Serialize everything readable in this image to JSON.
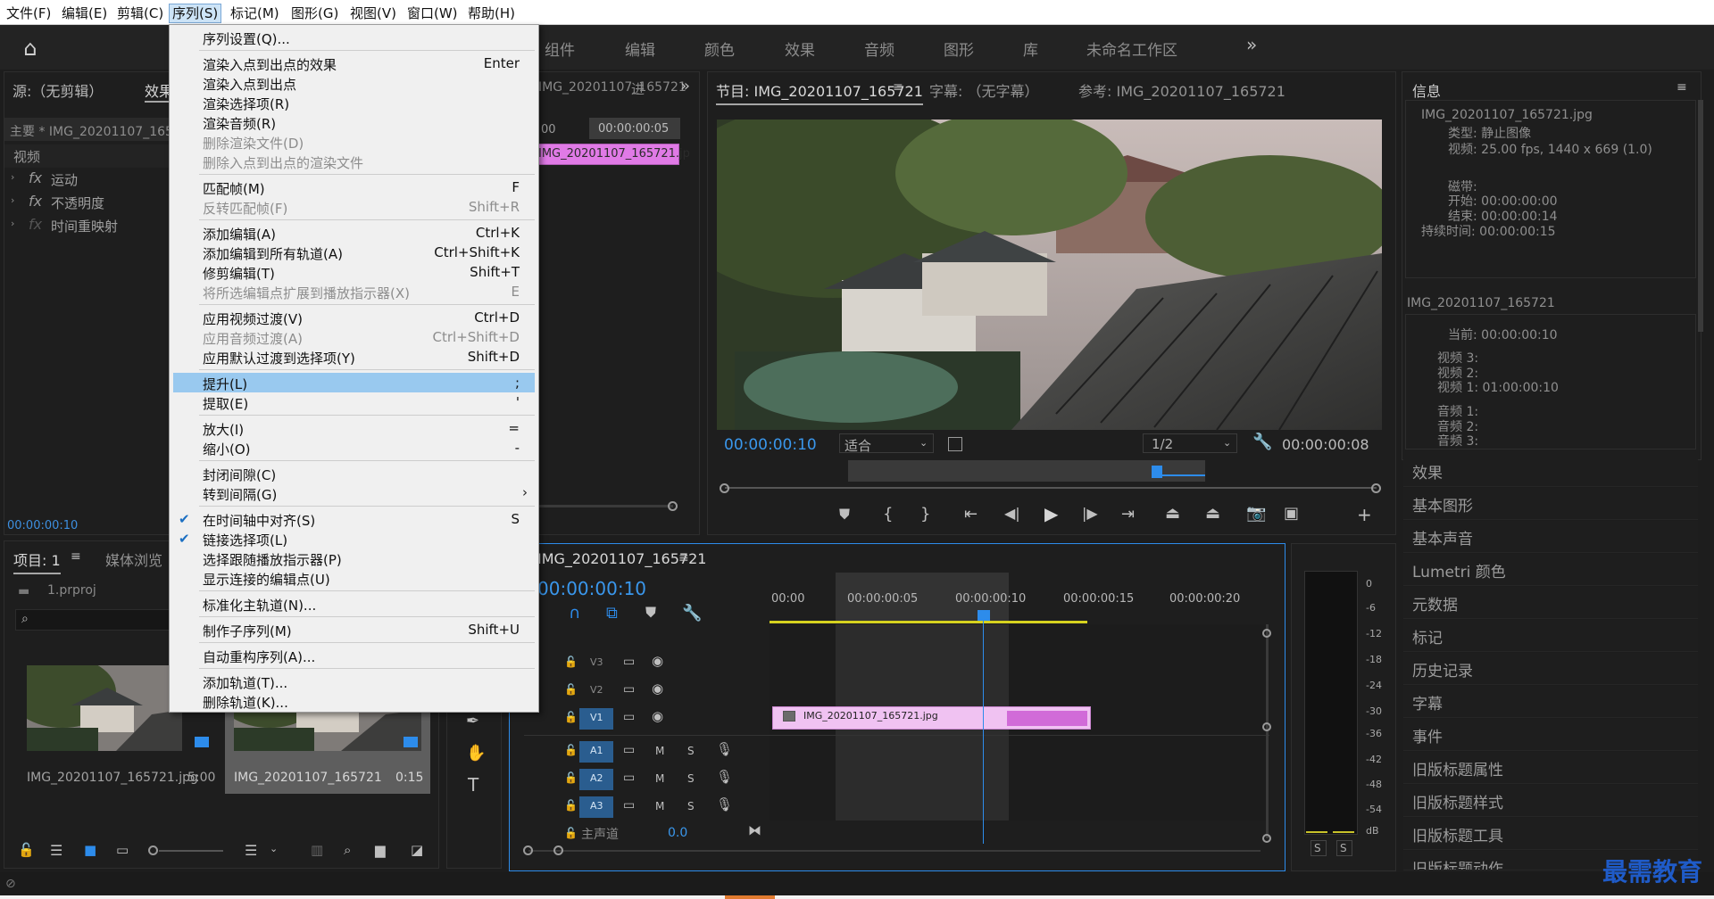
{
  "menubar": {
    "items": [
      "文件(F)",
      "编辑(E)",
      "剪辑(C)",
      "序列(S)",
      "标记(M)",
      "图形(G)",
      "视图(V)",
      "窗口(W)",
      "帮助(H)"
    ]
  },
  "workspaces": [
    "组件",
    "编辑",
    "颜色",
    "效果",
    "音频",
    "图形",
    "库",
    "未命名工作区"
  ],
  "source_panel": {
    "title": "源:（无剪辑）",
    "effects_tab": "效果",
    "clip_label": "主要 * IMG_20201107_165",
    "video": "视频",
    "effects": [
      "运动",
      "不透明度",
      "时间重映射"
    ],
    "timecode": "00:00:00:10"
  },
  "mini_timeline": {
    "clip_name": "IMG_20201107_165721",
    "tab": "进",
    "tc_left": "00",
    "tc": "00:00:00:05",
    "clip": "IMG_20201107_165721.jp"
  },
  "program": {
    "title": "节目: IMG_20201107_165721",
    "captions": "字幕: （无字幕）",
    "reference": "参考: IMG_20201107_165721",
    "timecode": "00:00:00:10",
    "fit": "适合",
    "resolution": "1/2",
    "duration": "00:00:00:08"
  },
  "info_panel": {
    "title": "信息",
    "file": "IMG_20201107_165721.jpg",
    "type": "类型: 静止图像",
    "video": "视频: 25.00 fps, 1440 x 669 (1.0)",
    "tape_label": "磁带:",
    "start": "开始: 00:00:00:00",
    "end": "结束: 00:00:00:14",
    "duration": "持续时间: 00:00:00:15",
    "seq_name": "IMG_20201107_165721",
    "current": "当前: 00:00:00:10",
    "v3": "视频 3:",
    "v2": "视频 2:",
    "v1": "视频 1: 01:00:00:10",
    "a1": "音频 1:",
    "a2": "音频 2:",
    "a3": "音频 3:"
  },
  "right_panels": [
    "效果",
    "基本图形",
    "基本声音",
    "Lumetri 颜色",
    "元数据",
    "标记",
    "历史记录",
    "字幕",
    "事件",
    "旧版标题属性",
    "旧版标题样式",
    "旧版标题工具",
    "旧版标题动作"
  ],
  "project": {
    "title": "项目: 1",
    "media_browser": "媒体浏览",
    "file": "1.prproj",
    "item1": "IMG_20201107_165721.jpg",
    "item1_dur": "5:00",
    "item2": "IMG_20201107_165721",
    "item2_dur": "0:15"
  },
  "timeline": {
    "title": "IMG_20201107_165721",
    "timecode": "00:00:00:10",
    "ruler": [
      "00:00",
      "00:00:00:05",
      "00:00:00:10",
      "00:00:00:15",
      "00:00:00:20"
    ],
    "tracks": [
      "V3",
      "V2",
      "V1",
      "A1",
      "A2",
      "A3"
    ],
    "clip": "IMG_20201107_165721.jpg",
    "master": "主声道",
    "master_val": "0.0"
  },
  "meter": {
    "scale": [
      "0",
      "-6",
      "-12",
      "-18",
      "-24",
      "-30",
      "-36",
      "-42",
      "-48",
      "-54",
      "dB"
    ],
    "solo": [
      "S",
      "S"
    ]
  },
  "dropdown": {
    "items": [
      {
        "label": "序列设置(Q)...",
        "shortcut": ""
      },
      {
        "label": "渲染入点到出点的效果",
        "shortcut": "Enter"
      },
      {
        "label": "渲染入点到出点",
        "shortcut": ""
      },
      {
        "label": "渲染选择项(R)",
        "shortcut": ""
      },
      {
        "label": "渲染音频(R)",
        "shortcut": ""
      },
      {
        "label": "删除渲染文件(D)",
        "shortcut": ""
      },
      {
        "label": "删除入点到出点的渲染文件",
        "shortcut": ""
      },
      {
        "label": "匹配帧(M)",
        "shortcut": "F"
      },
      {
        "label": "反转匹配帧(F)",
        "shortcut": "Shift+R"
      },
      {
        "label": "添加编辑(A)",
        "shortcut": "Ctrl+K"
      },
      {
        "label": "添加编辑到所有轨道(A)",
        "shortcut": "Ctrl+Shift+K"
      },
      {
        "label": "修剪编辑(T)",
        "shortcut": "Shift+T"
      },
      {
        "label": "将所选编辑点扩展到播放指示器(X)",
        "shortcut": "E"
      },
      {
        "label": "应用视频过渡(V)",
        "shortcut": "Ctrl+D"
      },
      {
        "label": "应用音频过渡(A)",
        "shortcut": "Ctrl+Shift+D"
      },
      {
        "label": "应用默认过渡到选择项(Y)",
        "shortcut": "Shift+D"
      },
      {
        "label": "提升(L)",
        "shortcut": ";"
      },
      {
        "label": "提取(E)",
        "shortcut": "'"
      },
      {
        "label": "放大(I)",
        "shortcut": "="
      },
      {
        "label": "缩小(O)",
        "shortcut": "-"
      },
      {
        "label": "封闭间隙(C)",
        "shortcut": ""
      },
      {
        "label": "转到间隔(G)",
        "shortcut": ""
      },
      {
        "label": "在时间轴中对齐(S)",
        "shortcut": "S"
      },
      {
        "label": "链接选择项(L)",
        "shortcut": ""
      },
      {
        "label": "选择跟随播放指示器(P)",
        "shortcut": ""
      },
      {
        "label": "显示连接的编辑点(U)",
        "shortcut": ""
      },
      {
        "label": "标准化主轨道(N)...",
        "shortcut": ""
      },
      {
        "label": "制作子序列(M)",
        "shortcut": "Shift+U"
      },
      {
        "label": "自动重构序列(A)...",
        "shortcut": ""
      },
      {
        "label": "添加轨道(T)...",
        "shortcut": ""
      },
      {
        "label": "删除轨道(K)...",
        "shortcut": ""
      }
    ]
  },
  "watermark": "最需教育",
  "colors": {
    "accent": "#2d8ceb",
    "clip": "#e7b7ee",
    "clip_dark": "#d16bd8",
    "menu_hl": "#99c9ef"
  }
}
